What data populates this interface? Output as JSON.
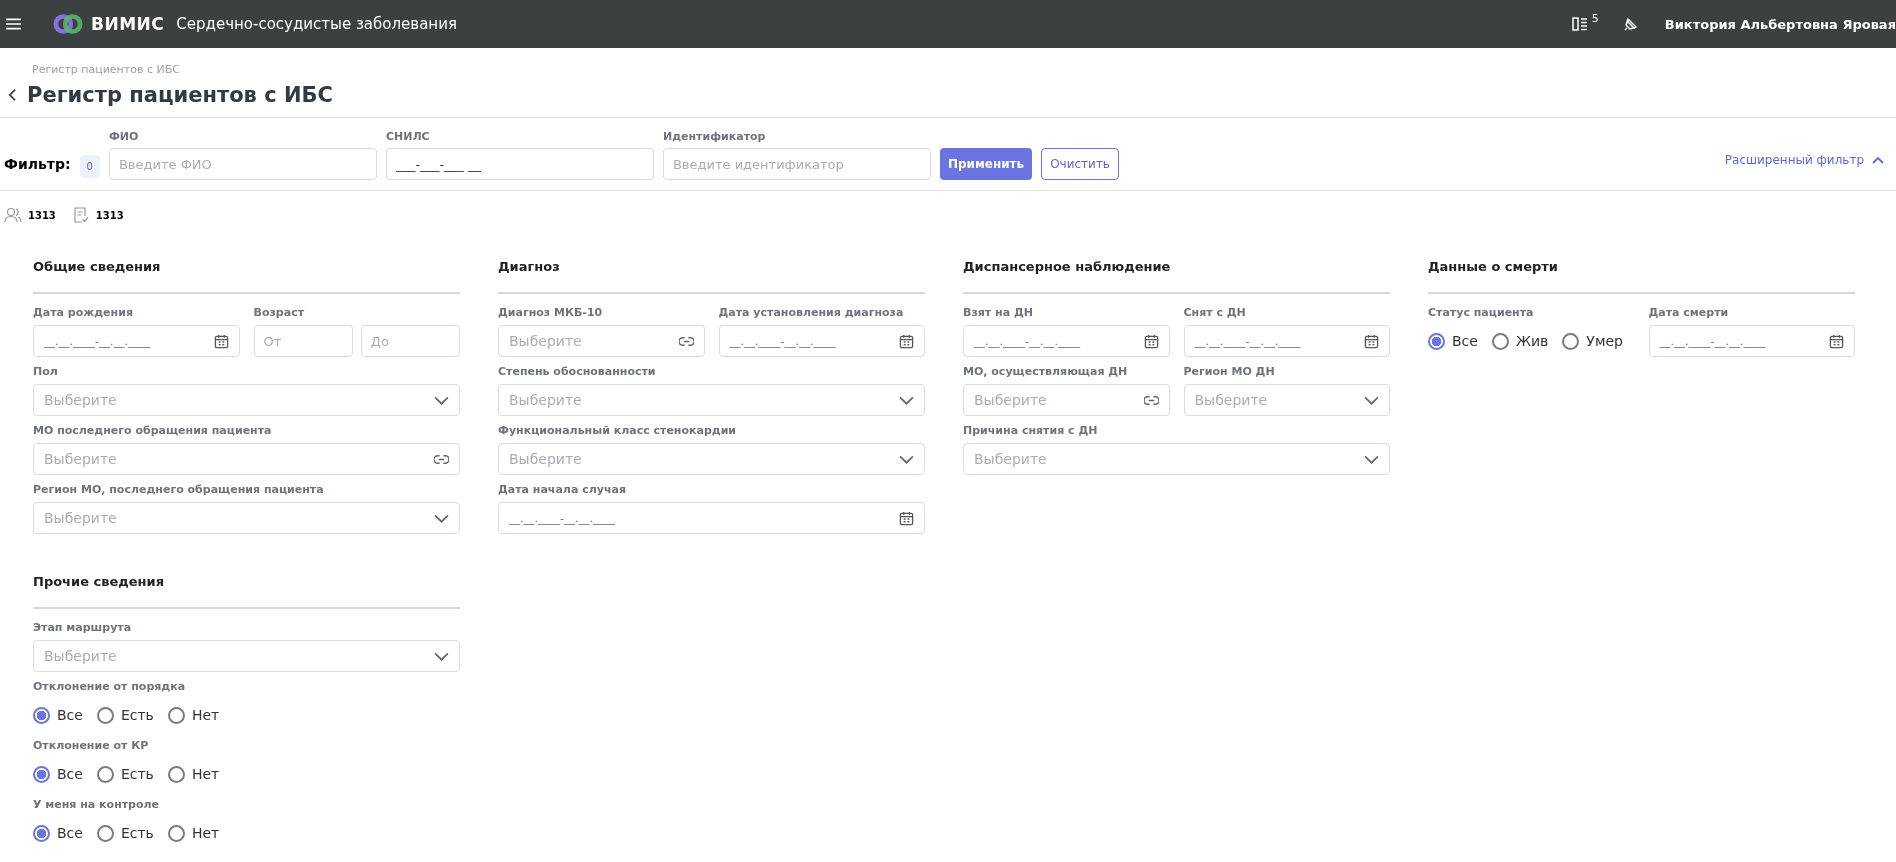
{
  "header": {
    "app_name": "ВИМИС",
    "subtitle": "Сердечно-сосудистые заболевания",
    "list_count": "5",
    "user_name": "Виктория Альбертовна Яровая"
  },
  "breadcrumb": "Регистр пациентов с ИБС",
  "title": "Регистр пациентов с ИБС",
  "filter": {
    "label": "Фильтр:",
    "count": "0",
    "fields": [
      {
        "label": "ФИО",
        "placeholder": "Введите ФИО"
      },
      {
        "label": "СНИЛС",
        "value": "___-___-___ __"
      },
      {
        "label": "Идентификатор",
        "placeholder": "Введите идентификатор"
      }
    ],
    "apply": "Применить",
    "clear": "Очистить",
    "advanced": "Расширенный фильтр",
    "advanced_expanded": true
  },
  "stats": [
    {
      "kind": "patients",
      "value": "1313"
    },
    {
      "kind": "records",
      "value": "1313"
    }
  ],
  "columns": [
    [
      {
        "title": "Общие сведения",
        "rows": [
          [
            {
              "kind": "date",
              "label": "Дата рождения",
              "value": "__.__.____-__.__.____"
            },
            {
              "kind": "range",
              "label": "Возраст",
              "placeholders": [
                "От",
                "До"
              ]
            }
          ],
          [
            {
              "kind": "select",
              "label": "Пол",
              "placeholder": "Выберите"
            }
          ],
          [
            {
              "kind": "lookup",
              "label": "МО последнего обращения пациента",
              "placeholder": "Выберите"
            }
          ],
          [
            {
              "kind": "select",
              "label": "Регион МО, последнего обращения пациента",
              "placeholder": "Выберите"
            }
          ]
        ]
      },
      {
        "title": "Прочие сведения",
        "rows": [
          [
            {
              "kind": "select",
              "label": "Этап маршрута",
              "placeholder": "Выберите"
            }
          ],
          [
            {
              "kind": "radio",
              "label": "Отклонение от порядка",
              "options": [
                {
                  "label": "Все",
                  "selected": true
                },
                {
                  "label": "Есть",
                  "selected": false
                },
                {
                  "label": "Нет",
                  "selected": false
                }
              ]
            }
          ],
          [
            {
              "kind": "radio",
              "label": "Отклонение от КР",
              "options": [
                {
                  "label": "Все",
                  "selected": true
                },
                {
                  "label": "Есть",
                  "selected": false
                },
                {
                  "label": "Нет",
                  "selected": false
                }
              ]
            }
          ],
          [
            {
              "kind": "radio",
              "label": "У меня на контроле",
              "options": [
                {
                  "label": "Все",
                  "selected": true
                },
                {
                  "label": "Есть",
                  "selected": false
                },
                {
                  "label": "Нет",
                  "selected": false
                }
              ]
            }
          ]
        ]
      }
    ],
    [
      {
        "title": "Диагноз",
        "rows": [
          [
            {
              "kind": "lookup",
              "label": "Диагноз МКБ-10",
              "placeholder": "Выберите"
            },
            {
              "kind": "date",
              "label": "Дата установления диагноза",
              "value": "__.__.____-__.__.____"
            }
          ],
          [
            {
              "kind": "select",
              "label": "Степень обоснованности",
              "placeholder": "Выберите"
            }
          ],
          [
            {
              "kind": "select",
              "label": "Функциональный класс стенокардии",
              "placeholder": "Выберите"
            }
          ],
          [
            {
              "kind": "date",
              "label": "Дата начала случая",
              "value": "__.__.____-__.__.____"
            }
          ]
        ]
      }
    ],
    [
      {
        "title": "Диспансерное наблюдение",
        "rows": [
          [
            {
              "kind": "date",
              "label": "Взят на ДН",
              "value": "__.__.____-__.__.____"
            },
            {
              "kind": "date",
              "label": "Снят с ДН",
              "value": "__.__.____-__.__.____"
            }
          ],
          [
            {
              "kind": "lookup",
              "label": "МО, осуществляющая ДН",
              "placeholder": "Выберите"
            },
            {
              "kind": "select",
              "label": "Регион МО ДН",
              "placeholder": "Выберите"
            }
          ],
          [
            {
              "kind": "select",
              "label": "Причина снятия с ДН",
              "placeholder": "Выберите"
            }
          ]
        ]
      }
    ],
    [
      {
        "title": "Данные о смерти",
        "rows": [
          [
            {
              "kind": "radio",
              "label": "Статус пациента",
              "options": [
                {
                  "label": "Все",
                  "selected": true
                },
                {
                  "label": "Жив",
                  "selected": false
                },
                {
                  "label": "Умер",
                  "selected": false
                }
              ]
            },
            {
              "kind": "date",
              "label": "Дата смерти",
              "value": "__.__.____-__.__.____"
            }
          ]
        ]
      }
    ]
  ]
}
